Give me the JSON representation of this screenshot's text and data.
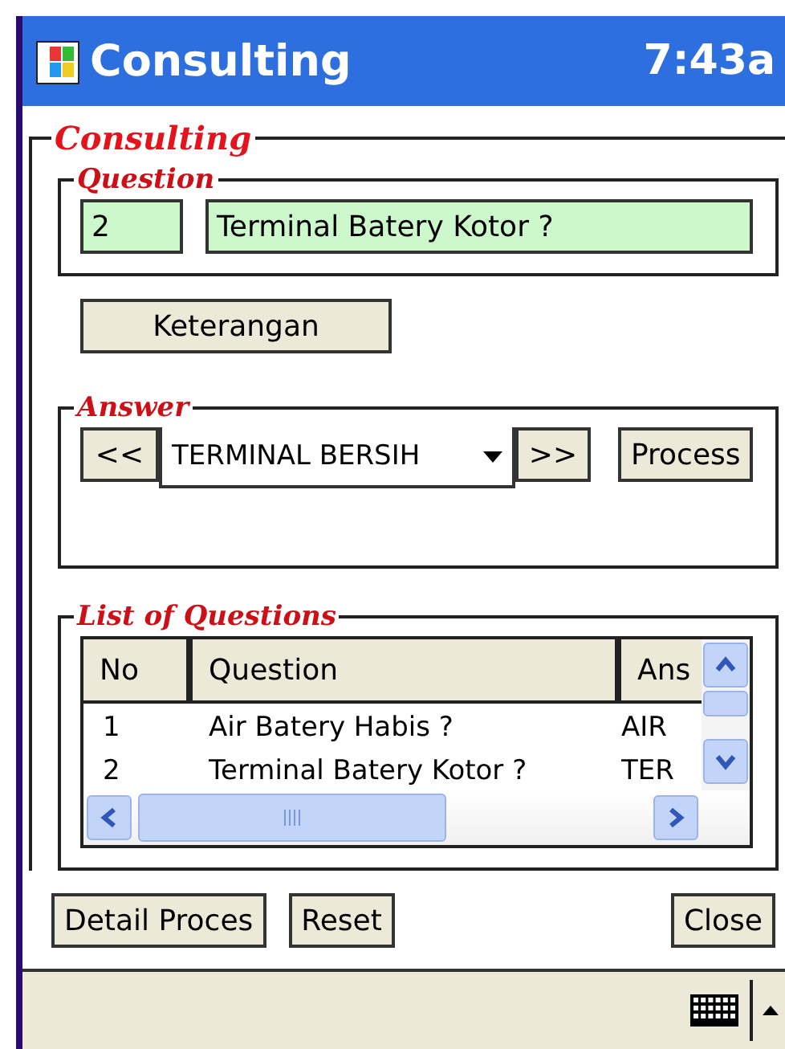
{
  "window": {
    "title": "Consulting",
    "time": "7:43a"
  },
  "main_group": {
    "title": "Consulting"
  },
  "question": {
    "title": "Question",
    "number": "2",
    "text": "Terminal Batery Kotor ?"
  },
  "info_button": "Keterangan",
  "answer": {
    "title": "Answer",
    "prev": "<<",
    "value": "TERMINAL BERSIH",
    "next": ">>",
    "process": "Process"
  },
  "list": {
    "title": "List of Questions",
    "columns": [
      "No",
      "Question",
      "Ans"
    ],
    "rows": [
      {
        "no": "1",
        "question": "Air Batery Habis ?",
        "answer": "AIR"
      },
      {
        "no": "2",
        "question": "Terminal Batery Kotor ?",
        "answer": "TER"
      }
    ]
  },
  "buttons": [
    "Detail Proces",
    "Reset",
    "Close"
  ]
}
